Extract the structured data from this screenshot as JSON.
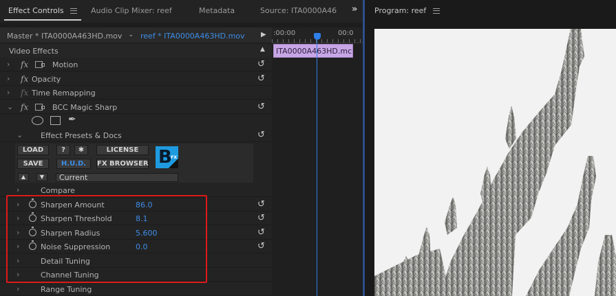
{
  "tabs": {
    "effect_controls": "Effect Controls",
    "audio_clip_mixer": "Audio Clip Mixer: reef",
    "metadata": "Metadata",
    "source": "Source: ITA0000A46",
    "overflow": "»"
  },
  "clip_bar": {
    "master": "Master * ITA0000A463HD.mov",
    "dropdown": "⌄",
    "sequence_clip": "reef * ITA0000A463HD.mov",
    "play": "▶"
  },
  "timeline": {
    "time_start": ":00:00",
    "time_end": "00:0",
    "clip_name": "ITA0000A463HD.mc"
  },
  "video_effects": {
    "header": "Video Effects",
    "collapse": "▲",
    "motion": "Motion",
    "opacity": "Opacity",
    "time_remapping": "Time Remapping",
    "bcc": "BCC Magic Sharp",
    "fx_label": "fx"
  },
  "bcc": {
    "presets": "Effect Presets & Docs",
    "load": "LOAD",
    "help": "?",
    "gear": "✱",
    "license": "LICENSE",
    "save": "SAVE",
    "hud": "H.U.D.",
    "fx_browser": "FX BROWSER",
    "logo_letter": "B",
    "logo_sup": "FX",
    "up": "▲",
    "down": "▼",
    "preset_value": "Current",
    "compare": "Compare",
    "sharpen_amount": "Sharpen Amount",
    "sharpen_amount_val": "86.0",
    "sharpen_threshold": "Sharpen Threshold",
    "sharpen_threshold_val": "8.1",
    "sharpen_radius": "Sharpen Radius",
    "sharpen_radius_val": "5.600",
    "noise_suppression": "Noise Suppression",
    "noise_suppression_val": "0.0",
    "detail_tuning": "Detail Tuning",
    "channel_tuning": "Channel Tuning",
    "range_tuning": "Range Tuning"
  },
  "glyphs": {
    "chev_right": "›",
    "chev_down": "⌄",
    "reset": "↺",
    "pen": "✒"
  },
  "program": {
    "title": "Program: reef"
  }
}
